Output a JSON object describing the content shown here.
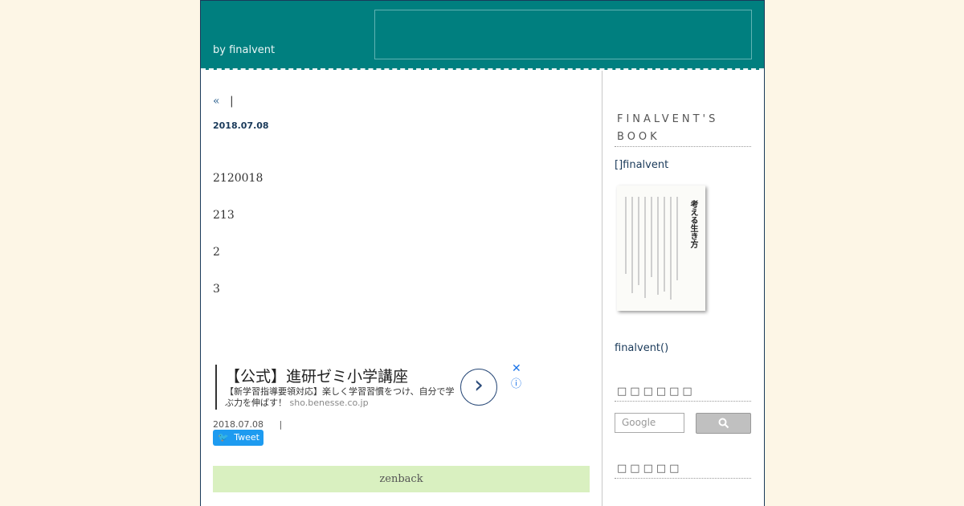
{
  "header": {
    "byline": "by finalvent"
  },
  "entry": {
    "nav_prev": "«",
    "nav_sep": "|",
    "date": "2018.07.08",
    "lines": [
      "2120018",
      "213",
      "2",
      "3"
    ],
    "footer_date": "2018.07.08",
    "footer_sep": "|",
    "tweet_label": "Tweet",
    "zenback_label": "zenback"
  },
  "ad": {
    "title": "【公式】進研ゼミ小学講座",
    "description": "【新学習指導要領対応】楽しく学習習慣をつけ、自分で学ぶ力を伸ばす！",
    "domain": "sho.benesse.co.jp",
    "close_icon": "✕",
    "info_icon": "ⓘ",
    "arrow_icon": "›"
  },
  "sidebar": {
    "book_heading": "FINALVENT'S BOOK",
    "book_link": "[]finalvent",
    "book_title": "考える生き方",
    "author_link": "finalvent()",
    "search_heading": "□□□□□□",
    "search_placeholder": "Google",
    "search_icon": "search-icon",
    "recent_heading": "□□□□□"
  },
  "colors": {
    "background": "#fdf6e6",
    "header": "#007f7f",
    "zenback": "#d9f0c0",
    "tweet": "#1d9bf0"
  }
}
